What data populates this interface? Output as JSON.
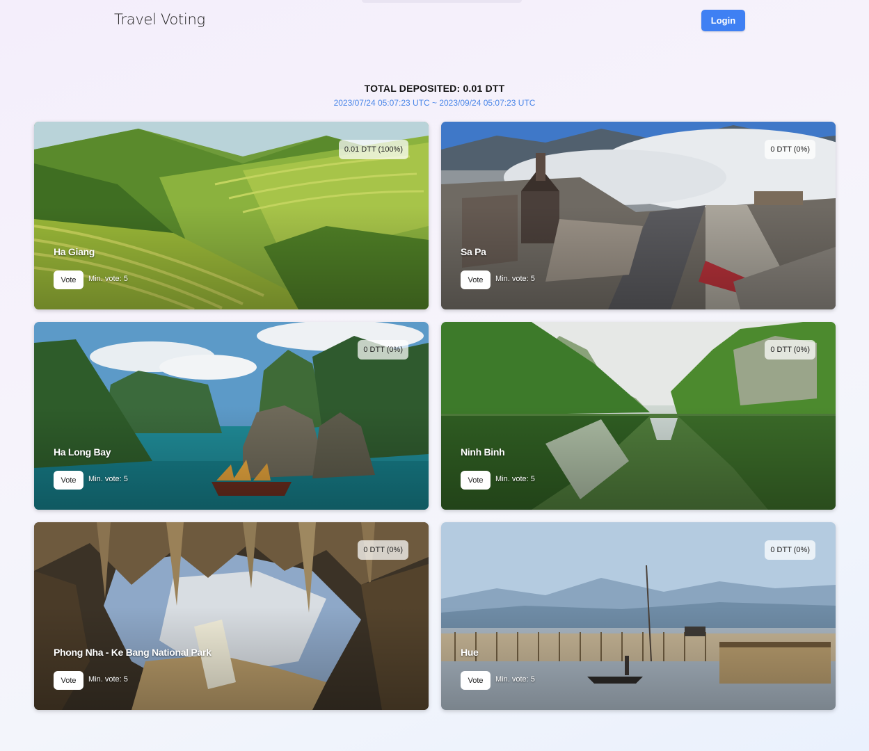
{
  "header": {
    "title": "Travel Voting",
    "login_label": "Login"
  },
  "summary": {
    "total": "TOTAL DEPOSITED: 0.01 DTT",
    "period": "2023/07/24 05:07:23 UTC ~ 2023/09/24 05:07:23 UTC"
  },
  "cards": [
    {
      "name": "Ha Giang",
      "badge": "0.01 DTT (100%)",
      "vote_label": "Vote",
      "min_vote": "Min. vote: 5"
    },
    {
      "name": "Sa Pa",
      "badge": "0 DTT (0%)",
      "vote_label": "Vote",
      "min_vote": "Min. vote: 5"
    },
    {
      "name": "Ha Long Bay",
      "badge": "0 DTT (0%)",
      "vote_label": "Vote",
      "min_vote": "Min. vote: 5"
    },
    {
      "name": "Ninh Binh",
      "badge": "0 DTT (0%)",
      "vote_label": "Vote",
      "min_vote": "Min. vote: 5"
    },
    {
      "name": "Phong Nha - Ke Bang National Park",
      "badge": "0 DTT (0%)",
      "vote_label": "Vote",
      "min_vote": "Min. vote: 5"
    },
    {
      "name": "Hue",
      "badge": "0 DTT (0%)",
      "vote_label": "Vote",
      "min_vote": "Min. vote: 5"
    }
  ],
  "colors": {
    "accent": "#3f80f3",
    "date_text": "#4a86e8",
    "title_text": "#111111"
  }
}
